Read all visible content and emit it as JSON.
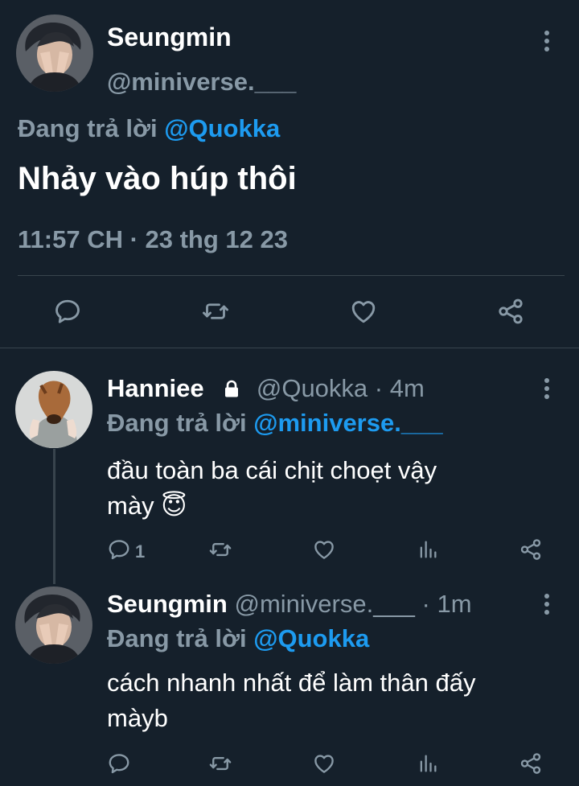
{
  "main_tweet": {
    "display_name": "Seungmin",
    "handle": "@miniverse.___",
    "replying_prefix": "Đang trả lời",
    "replying_to": "@Quokka",
    "text": "Nhảy vào húp thôi",
    "timestamp": "11:57 CH · 23 thg 12 23"
  },
  "replies": [
    {
      "display_name": "Hanniee",
      "handle": "@Quokka",
      "separator": "·",
      "time": "4m",
      "replying_prefix": "Đang trả lời",
      "replying_to": "@miniverse.___",
      "text_line1": "đầu toàn ba cái chịt choẹt vậy",
      "text_line2": "mày",
      "emoji": "😇",
      "reply_count": "1",
      "locked": true
    },
    {
      "display_name": "Seungmin",
      "handle": "@miniverse.___",
      "separator": "·",
      "time": "1m",
      "replying_prefix": "Đang trả lời",
      "replying_to": "@Quokka",
      "text_line1": "cách nhanh nhất để làm thân đấy",
      "text_line2": "màyb"
    }
  ],
  "icons": {
    "reply": "speech-bubble-icon",
    "retweet": "retweet-arrows-icon",
    "like": "heart-icon",
    "share": "share-icon",
    "analytics": "bar-chart-icon",
    "more": "vertical-dots-icon",
    "lock": "lock-icon"
  },
  "colors": {
    "background": "#15202b",
    "text": "#ffffff",
    "muted": "#8899a6",
    "link": "#1d9bf0",
    "divider": "#38444d"
  }
}
